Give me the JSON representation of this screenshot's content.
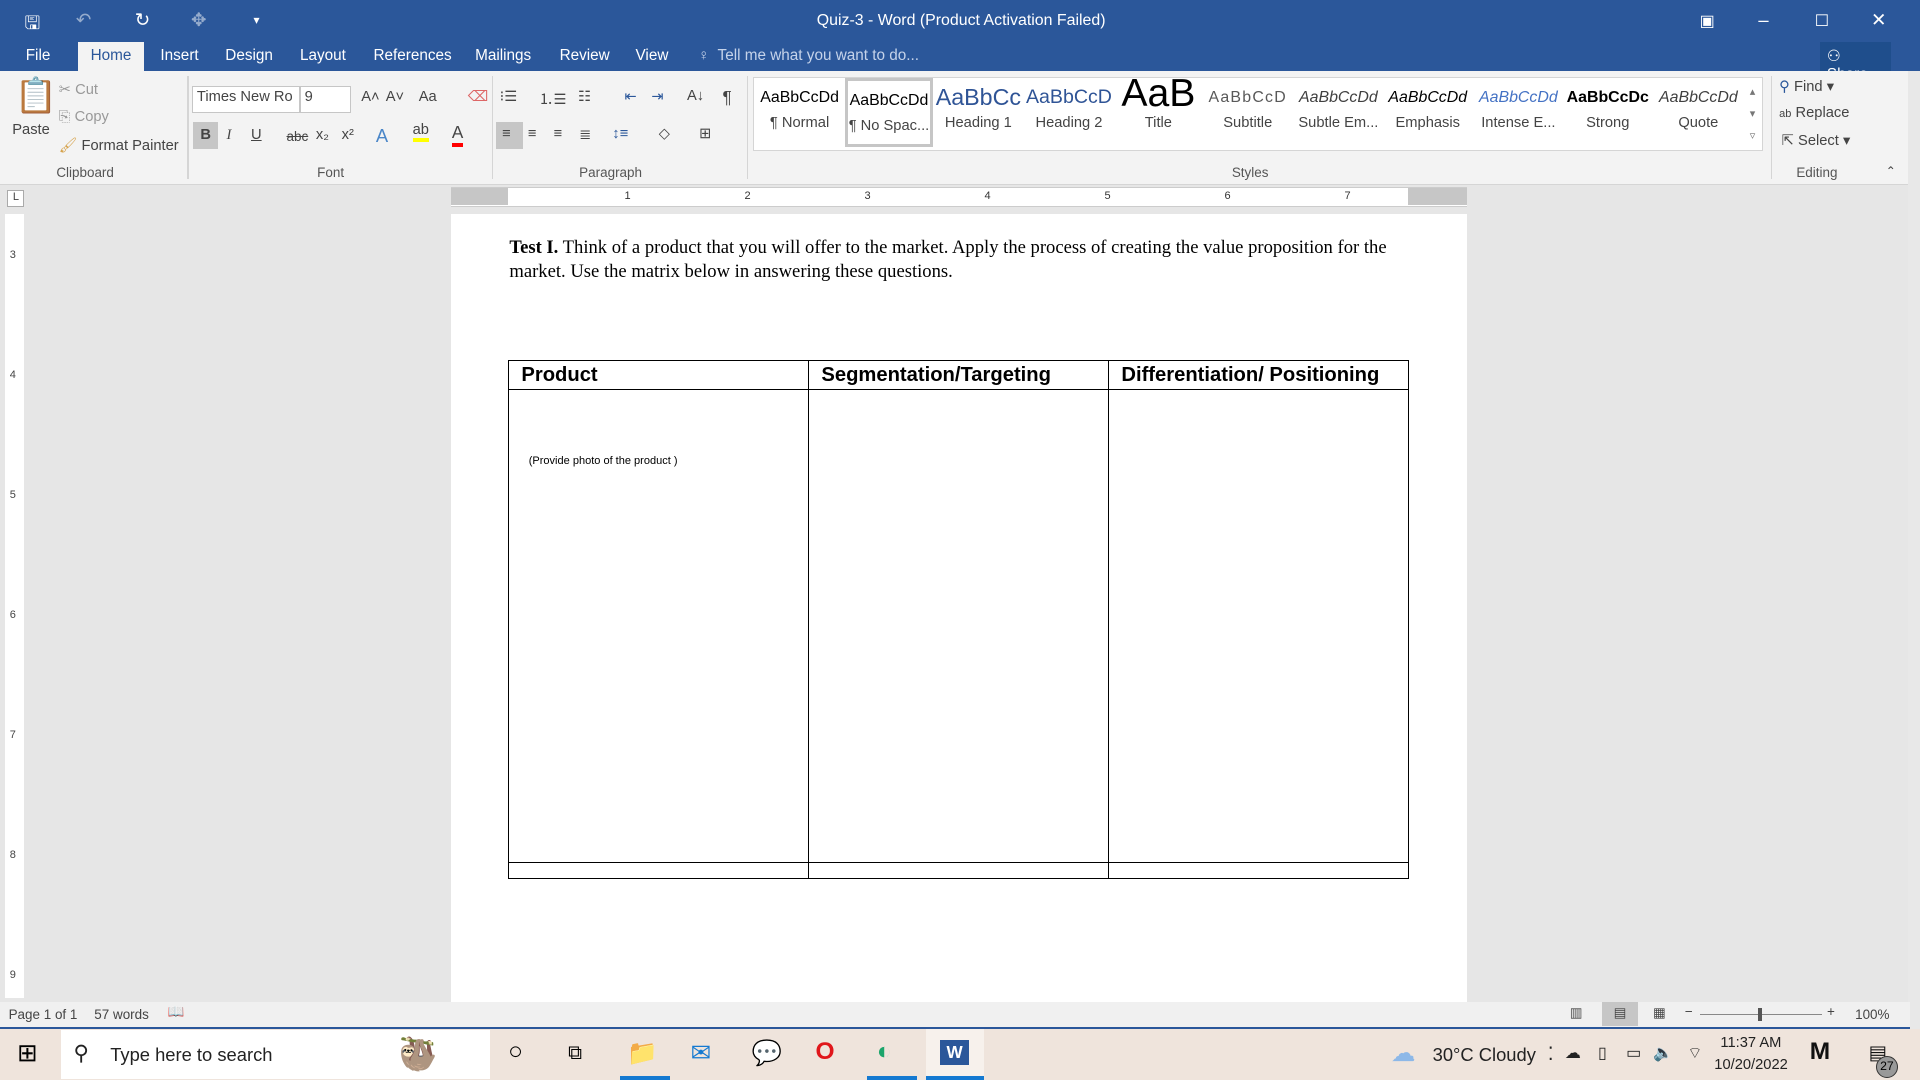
{
  "window": {
    "title": "Quiz-3 - Word (Product Activation Failed)"
  },
  "quick_access": {
    "save": "save-icon",
    "undo": "undo-icon",
    "redo": "redo-icon",
    "touch": "touch-mode-icon",
    "customize": "customize-icon"
  },
  "tabs": [
    {
      "label": "File"
    },
    {
      "label": "Home"
    },
    {
      "label": "Insert"
    },
    {
      "label": "Design"
    },
    {
      "label": "Layout"
    },
    {
      "label": "References"
    },
    {
      "label": "Mailings"
    },
    {
      "label": "Review"
    },
    {
      "label": "View"
    }
  ],
  "tell_me": "Tell me what you want to do...",
  "share": "Share",
  "clipboard": {
    "paste": "Paste",
    "cut": "Cut",
    "copy": "Copy",
    "format_painter": "Format Painter",
    "label": "Clipboard"
  },
  "font": {
    "name": "Times New Ro",
    "size": "9",
    "label": "Font",
    "change_case": "Aa",
    "highlight_color": "#ffff00",
    "font_color": "#ff0000"
  },
  "paragraph": {
    "label": "Paragraph"
  },
  "styles": {
    "label": "Styles",
    "items": [
      {
        "sample": "AaBbCcDd",
        "name": "¶ Normal"
      },
      {
        "sample": "AaBbCcDd",
        "name": "¶ No Spac..."
      },
      {
        "sample": "AaBbCc",
        "name": "Heading 1"
      },
      {
        "sample": "AaBbCcD",
        "name": "Heading 2"
      },
      {
        "sample": "AaB",
        "name": "Title"
      },
      {
        "sample": "AaBbCcD",
        "name": "Subtitle"
      },
      {
        "sample": "AaBbCcDd",
        "name": "Subtle Em..."
      },
      {
        "sample": "AaBbCcDd",
        "name": "Emphasis"
      },
      {
        "sample": "AaBbCcDd",
        "name": "Intense E..."
      },
      {
        "sample": "AaBbCcDc",
        "name": "Strong"
      },
      {
        "sample": "AaBbCcDd",
        "name": "Quote"
      }
    ]
  },
  "editing": {
    "find": "Find",
    "replace": "Replace",
    "select": "Select",
    "label": "Editing"
  },
  "ruler": {
    "h": [
      "1",
      "2",
      "3",
      "4",
      "5",
      "6",
      "7"
    ],
    "v": [
      "3",
      "4",
      "5",
      "6",
      "7",
      "8",
      "9"
    ]
  },
  "document": {
    "intro_bold": "Test I.",
    "intro": " Think of a product that you will offer to the market. Apply the process of creating the value proposition for the market.  Use the matrix below in answering these questions.",
    "table": {
      "headers": [
        "Product",
        "Segmentation/Targeting",
        "Differentiation/ Positioning"
      ],
      "cell_note": "(Provide photo of the product )"
    }
  },
  "status": {
    "page": "Page 1 of 1",
    "words": "57 words",
    "zoom": "100%",
    "zoom_level_percent": 100
  },
  "taskbar": {
    "search": "Type here to search",
    "weather": "30°C  Cloudy",
    "time": "11:37 AM",
    "date": "10/20/2022",
    "notifications": "27"
  },
  "colors": {
    "accent": "#2b579a"
  }
}
